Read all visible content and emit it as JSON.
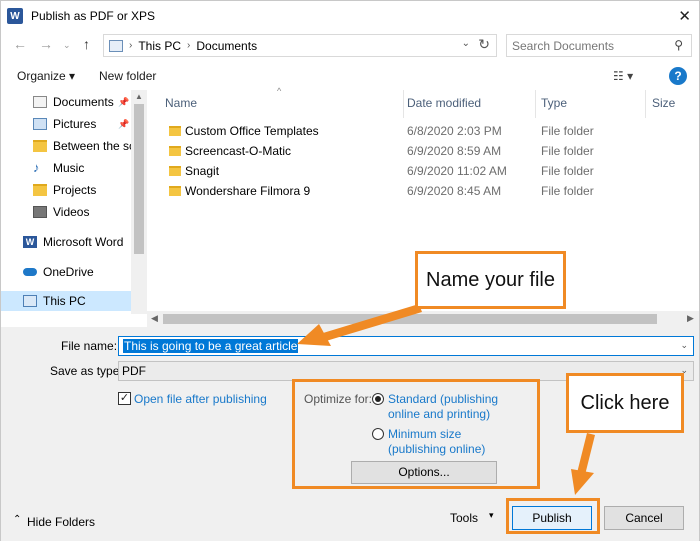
{
  "window": {
    "title": "Publish as PDF or XPS",
    "app_icon_letter": "W"
  },
  "address": {
    "crumbs": [
      "This PC",
      "Documents"
    ]
  },
  "search": {
    "placeholder": "Search Documents"
  },
  "toolbar": {
    "organize_label": "Organize ▾",
    "new_folder_label": "New folder"
  },
  "nav": {
    "items": [
      {
        "label": "Documents",
        "pinned": true,
        "icon": "documents-icon"
      },
      {
        "label": "Pictures",
        "pinned": true,
        "icon": "pictures-icon"
      },
      {
        "label": "Between the scri",
        "pinned": false,
        "icon": "folder-icon"
      },
      {
        "label": "Music",
        "pinned": false,
        "icon": "music-icon"
      },
      {
        "label": "Projects",
        "pinned": false,
        "icon": "folder-icon"
      },
      {
        "label": "Videos",
        "pinned": false,
        "icon": "videos-icon"
      },
      {
        "label": "Microsoft Word",
        "pinned": false,
        "icon": "word-icon"
      },
      {
        "label": "OneDrive",
        "pinned": false,
        "icon": "cloud-icon"
      },
      {
        "label": "This PC",
        "pinned": false,
        "icon": "computer-icon",
        "selected": true
      }
    ]
  },
  "files": {
    "columns": [
      "Name",
      "Date modified",
      "Type",
      "Size"
    ],
    "rows": [
      {
        "name": "Custom Office Templates",
        "date": "6/8/2020 2:03 PM",
        "type": "File folder"
      },
      {
        "name": "Screencast-O-Matic",
        "date": "6/9/2020 8:59 AM",
        "type": "File folder"
      },
      {
        "name": "Snagit",
        "date": "6/9/2020 11:02 AM",
        "type": "File folder"
      },
      {
        "name": "Wondershare Filmora 9",
        "date": "6/9/2020 8:45 AM",
        "type": "File folder"
      }
    ]
  },
  "form": {
    "file_name_label": "File name:",
    "file_name_value": "This is going to be a great article",
    "save_type_label": "Save as type:",
    "save_type_value": "PDF",
    "open_after_label": "Open file after publishing",
    "open_after_checked": true,
    "optimize_label": "Optimize for:",
    "standard_label_1": "Standard (publishing",
    "standard_label_2": "online and printing)",
    "minimum_label_1": "Minimum size",
    "minimum_label_2": "(publishing online)",
    "options_label": "Options..."
  },
  "footer": {
    "hide_folders_label": "Hide Folders",
    "tools_label": "Tools",
    "publish_label": "Publish",
    "cancel_label": "Cancel"
  },
  "annotations": {
    "name_callout": "Name your file",
    "click_callout": "Click here"
  },
  "colors": {
    "accent": "#0078d7",
    "annotation": "#f08a24",
    "link": "#1979ca"
  }
}
